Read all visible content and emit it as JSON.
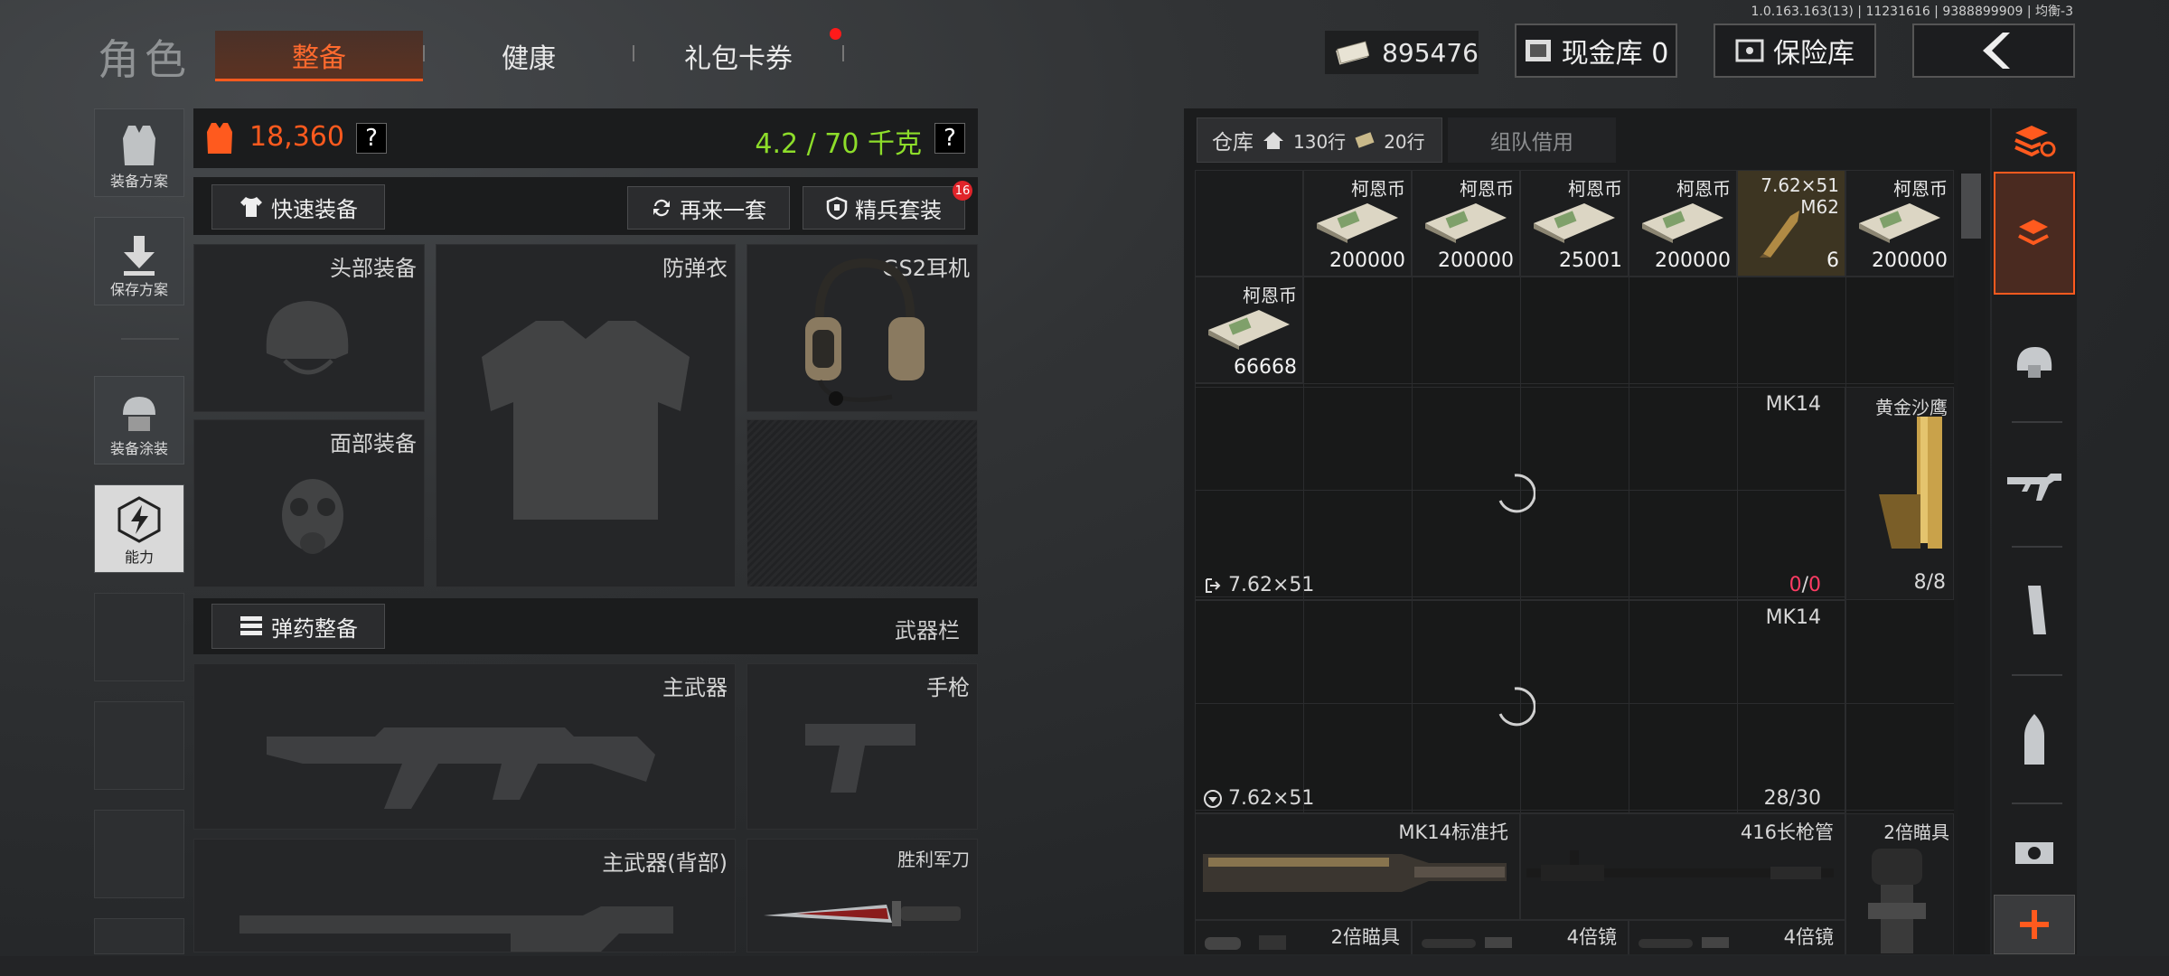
{
  "version": "1.0.163.163(13) | 11231616 | 9388899909 | 均衡-3",
  "page_title": "角色",
  "tabs": [
    {
      "label": "整备",
      "active": true
    },
    {
      "label": "健康",
      "active": false
    },
    {
      "label": "礼包卡券",
      "active": false,
      "badge": true
    }
  ],
  "header": {
    "money": "895476",
    "cash_vault": "现金库 0",
    "safe_box": "保险库"
  },
  "left_nav": [
    {
      "label": "装备方案",
      "icon": "vest-icon"
    },
    {
      "label": "保存方案",
      "icon": "download-icon"
    },
    {
      "label": "装备涂装",
      "icon": "helmet-paint-icon"
    },
    {
      "label": "能力",
      "icon": "lightning-icon"
    }
  ],
  "equipment": {
    "value": "18,360",
    "weight": "4.2 / 70 千克",
    "help": "?",
    "quick_equip": "快速装备",
    "again_set": "再来一套",
    "elite_set": "精兵套装",
    "elite_badge": "16",
    "slots": {
      "head": "头部装备",
      "armor": "防弹衣",
      "headset": "GS2耳机",
      "face": "面部装备",
      "ammo": "弹药整备",
      "weapon_bar": "武器栏",
      "primary": "主武器",
      "pistol": "手枪",
      "primary_back": "主武器(背部)",
      "knife": "胜利军刀"
    }
  },
  "warehouse": {
    "tab_label": "仓库",
    "rows": "130行",
    "extra_rows": "20行",
    "team_borrow": "组队借用",
    "cash_items": [
      {
        "name": "柯恩币",
        "count": "200000"
      },
      {
        "name": "柯恩币",
        "count": "200000"
      },
      {
        "name": "柯恩币",
        "count": "25001"
      },
      {
        "name": "柯恩币",
        "count": "200000"
      },
      {
        "name": "7.62×51\nM62",
        "count": "6"
      },
      {
        "name": "柯恩币",
        "count": "200000"
      },
      {
        "name": "柯恩币",
        "count": "66668"
      }
    ],
    "gun1": {
      "name": "MK14",
      "ammo": "7.62×51",
      "count_a": "0",
      "count_b": "0"
    },
    "deagle": {
      "name": "黄金沙鹰",
      "count": "8/8"
    },
    "gun2": {
      "name": "MK14",
      "ammo": "7.62×51",
      "count": "28/30"
    },
    "parts": [
      {
        "name": "MK14标准托"
      },
      {
        "name": "416长枪管"
      },
      {
        "name": "2倍瞄具"
      }
    ],
    "bottom_row": [
      {
        "name": "2倍瞄具"
      },
      {
        "name": "4倍镜"
      },
      {
        "name": "4倍镜"
      }
    ]
  },
  "colors": {
    "accent": "#ff5a1e",
    "weight_green": "#8ddd2a",
    "badge_red": "#ff1a1a"
  }
}
